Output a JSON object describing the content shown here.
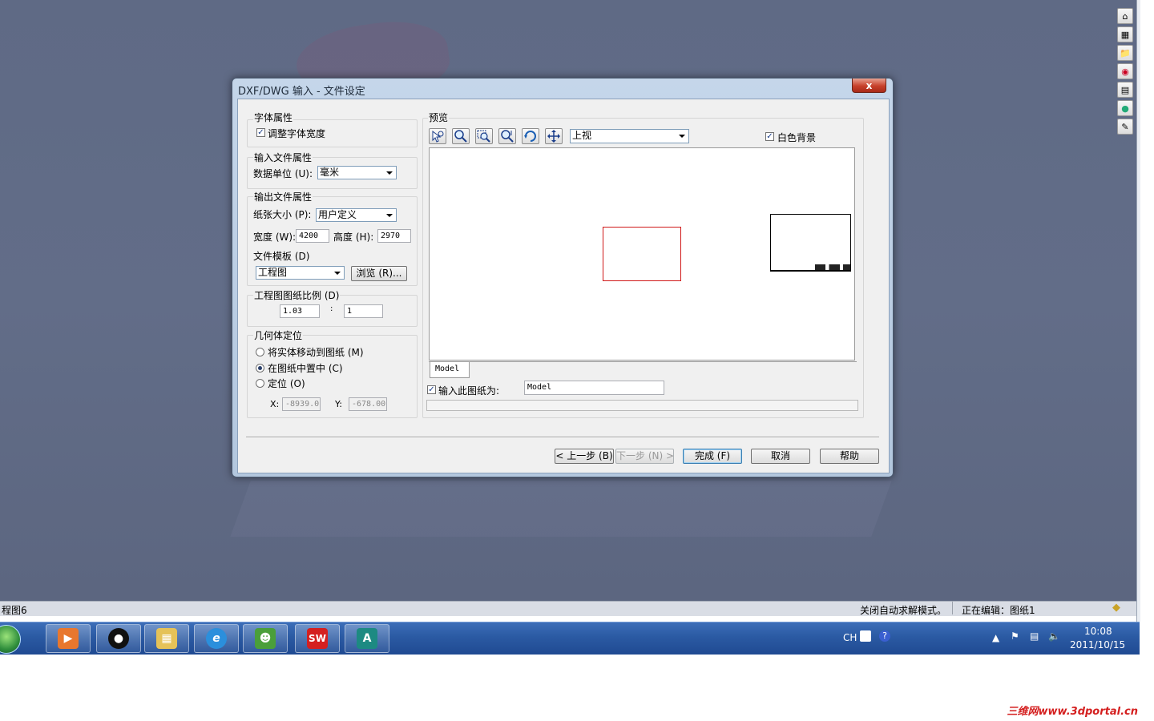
{
  "dialog": {
    "title": "DXF/DWG 输入 - 文件设定",
    "close_label": "x",
    "font_props": {
      "title": "字体属性",
      "adjust_width_label": "调整字体宽度",
      "adjust_width_checked": true
    },
    "input_props": {
      "title": "输入文件属性",
      "unit_label": "数据单位 (U):",
      "unit_value": "毫米"
    },
    "output_props": {
      "title": "输出文件属性",
      "paper_size_label": "纸张大小 (P):",
      "paper_size_value": "用户定义",
      "width_label": "宽度 (W):",
      "width_value": "4200",
      "height_label": "高度 (H):",
      "height_value": "2970",
      "template_label": "文件模板 (D)",
      "template_value": "工程图",
      "browse_label": "浏览 (R)..."
    },
    "scale": {
      "title": "工程图图纸比例 (D)",
      "value1": "1.03",
      "separator": ":",
      "value2": "1"
    },
    "geometry": {
      "title": "几何体定位",
      "options": [
        {
          "label": "将实体移动到图纸 (M)",
          "selected": false
        },
        {
          "label": "在图纸中置中 (C)",
          "selected": true
        },
        {
          "label": "定位 (O)",
          "selected": false
        }
      ],
      "x_label": "X:",
      "x_value": "-8939.0",
      "y_label": "Y:",
      "y_value": "-678.00"
    },
    "preview": {
      "title": "预览",
      "view_value": "上视",
      "white_bg_label": "白色背景",
      "white_bg_checked": true,
      "tab_label": "Model",
      "import_sheet_label": "输入此图纸为:",
      "import_sheet_checked": true,
      "import_sheet_value": "Model",
      "tools": [
        "select-zoom-icon",
        "zoom-icon",
        "zoom-window-icon",
        "zoom-fit-icon",
        "rotate-icon",
        "pan-icon"
      ]
    },
    "buttons": {
      "back": "< 上一步 (B)",
      "next": "下一步 (N) >",
      "finish": "完成 (F)",
      "cancel": "取消",
      "help": "帮助"
    }
  },
  "statusbar": {
    "left": "程图6",
    "mode": "关闭自动求解模式。",
    "editing": "正在编辑：图纸1"
  },
  "taskbar": {
    "apps": [
      "media-player-icon",
      "qq-icon",
      "file-explorer-icon",
      "internet-explorer-icon",
      "users-icon",
      "solidworks-icon",
      "autocad-icon"
    ],
    "lang": "CH",
    "time": "10:08",
    "date": "2011/10/15"
  },
  "watermark": "三维网www.3dportal.cn",
  "colors": {
    "accent": "#2b5aa3",
    "preview_rect": "#d01818"
  }
}
